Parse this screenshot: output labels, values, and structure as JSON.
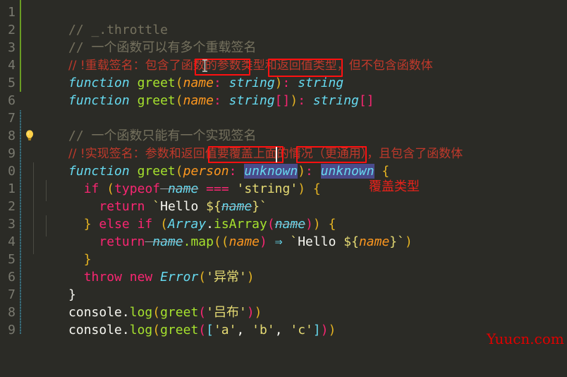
{
  "editor": {
    "theme_background": "#2b2b26",
    "gutter_background": "#2b2b26",
    "line_number_color": "#7a7a70",
    "change_bar_added_color": "#6a9d23",
    "change_bar_modified_color": "#3c6e7a",
    "annotation_box_color": "#ff1010",
    "selection_color": "#4a4a8a"
  },
  "gutter": {
    "line_numbers": [
      "1",
      "2",
      "3",
      "4",
      "5",
      "6",
      "7",
      "8",
      "9",
      "0",
      "1",
      "2",
      "3",
      "4",
      "5",
      "6",
      "7",
      "8",
      "9"
    ]
  },
  "lines": [
    {
      "n": "1",
      "text": "// _.throttle"
    },
    {
      "n": "2",
      "text": "// 一个函数可以有多个重载签名"
    },
    {
      "n": "3",
      "text": "// !重载签名：包含了函数的参数类型和返回值类型，但不包含函数体"
    },
    {
      "n": "4",
      "text": "function greet(name: string): string"
    },
    {
      "n": "5",
      "text": "function greet(name: string[]): string[]"
    },
    {
      "n": "6",
      "text": ""
    },
    {
      "n": "7",
      "text": "// 一个函数只能有一个实现签名"
    },
    {
      "n": "8",
      "text": "// !实现签名：参数和返回值要覆盖上面的情况（更通用），且包含了函数体"
    },
    {
      "n": "9",
      "text": "function greet(person: unknown): unknown {"
    },
    {
      "n": "10",
      "text": "  if (typeof name === 'string') {"
    },
    {
      "n": "11",
      "text": "    return `Hello ${name}`"
    },
    {
      "n": "12",
      "text": "  } else if (Array.isArray(name)) {"
    },
    {
      "n": "13",
      "text": "    return name.map((name) => `Hello ${name}`)"
    },
    {
      "n": "14",
      "text": "  }"
    },
    {
      "n": "15",
      "text": "  throw new Error('异常')"
    },
    {
      "n": "16",
      "text": "}"
    },
    {
      "n": "17",
      "text": "console.log(greet('吕布'))"
    },
    {
      "n": "18",
      "text": "console.log(greet(['a', 'b', 'c']))"
    },
    {
      "n": "19",
      "text": ""
    }
  ],
  "tokens": {
    "l1_comment": "// _.throttle",
    "l2_comment": "// 一个函数可以有多个重载签名",
    "l3_comment": "// !重载签名：包含了函数的参数类型和返回值类型，但不包含函数体",
    "l4_kw": "function",
    "l4_fn": " greet",
    "l4_open": "(",
    "l4_param": "name",
    "l4_colon": ":",
    "l4_type": " string",
    "l4_close": ")",
    "l4_colon2": ":",
    "l4_rettype": " string",
    "l5_kw": "function",
    "l5_fn": " greet",
    "l5_open": "(",
    "l5_param": "name",
    "l5_colon": ":",
    "l5_type": " string",
    "l5_brackets": "[]",
    "l5_close": ")",
    "l5_colon2": ":",
    "l5_rettype": " string",
    "l5_brackets2": "[]",
    "l7_comment": "// 一个函数只能有一个实现签名",
    "l8_comment": "// !实现签名：参数和返回值要覆盖上面的情况（更通用），且包含了函数体",
    "l9_kw": "function",
    "l9_fn": " greet",
    "l9_open": "(",
    "l9_param": "person",
    "l9_colon": ":",
    "l9_sp": " ",
    "l9_type": "unknown",
    "l9_close": ")",
    "l9_colon2": ":",
    "l9_rettype": "unknown",
    "l9_brace": " {",
    "l10_indent": "  ",
    "l10_if": "if",
    "l10_open": " (",
    "l10_typeof": "typeof",
    "l10_name": " name",
    "l10_eq": " === ",
    "l10_str": "'string'",
    "l10_close": ")",
    "l10_brace": " {",
    "l11_indent": "    ",
    "l11_return": "return",
    "l11_tick": " `",
    "l11_hello": "Hello ",
    "l11_dollar": "${",
    "l11_name": "name",
    "l11_closebrace": "}",
    "l11_tick2": "`",
    "l12_indent": "  ",
    "l12_closebrace": "}",
    "l12_else": " else ",
    "l12_if": "if",
    "l12_open": " (",
    "l12_array": "Array",
    "l12_dot": ".",
    "l12_isarray": "isArray",
    "l12_open2": "(",
    "l12_name": "name",
    "l12_close2": ")",
    "l12_close": ")",
    "l12_brace": " {",
    "l13_indent": "    ",
    "l13_return": "return",
    "l13_name": " name",
    "l13_dot": ".",
    "l13_map": "map",
    "l13_open": "((",
    "l13_param": "name",
    "l13_close": ")",
    "l13_arrow": " ⇒ ",
    "l13_tick": "`",
    "l13_hello": "Hello ",
    "l13_dollar": "${",
    "l13_name2": "name",
    "l13_closebrace": "}",
    "l13_tick2": "`",
    "l13_closeparen": ")",
    "l14_indent": "  ",
    "l14_brace": "}",
    "l15_indent": "  ",
    "l15_throw": "throw",
    "l15_new": " new ",
    "l15_error": "Error",
    "l15_open": "(",
    "l15_str": "'异常'",
    "l15_close": ")",
    "l16_brace": "}",
    "l17_console": "console",
    "l17_dot": ".",
    "l17_log": "log",
    "l17_open": "(",
    "l17_greet": "greet",
    "l17_open2": "(",
    "l17_str": "'吕布'",
    "l17_close2": ")",
    "l17_close": ")",
    "l18_console": "console",
    "l18_dot": ".",
    "l18_log": "log",
    "l18_open": "(",
    "l18_greet": "greet",
    "l18_open2": "(",
    "l18_bracket": "[",
    "l18_a": "'a'",
    "l18_c1": ", ",
    "l18_b": "'b'",
    "l18_c2": ", ",
    "l18_c": "'c'",
    "l18_bracket2": "]",
    "l18_close2": ")",
    "l18_close": ")"
  },
  "annotations": {
    "overlay_note": "覆盖类型",
    "watermark": "Yuucn.com",
    "lightbulb_icon": "lightbulb-icon",
    "cursor_icon": "text-ibeam-cursor"
  }
}
